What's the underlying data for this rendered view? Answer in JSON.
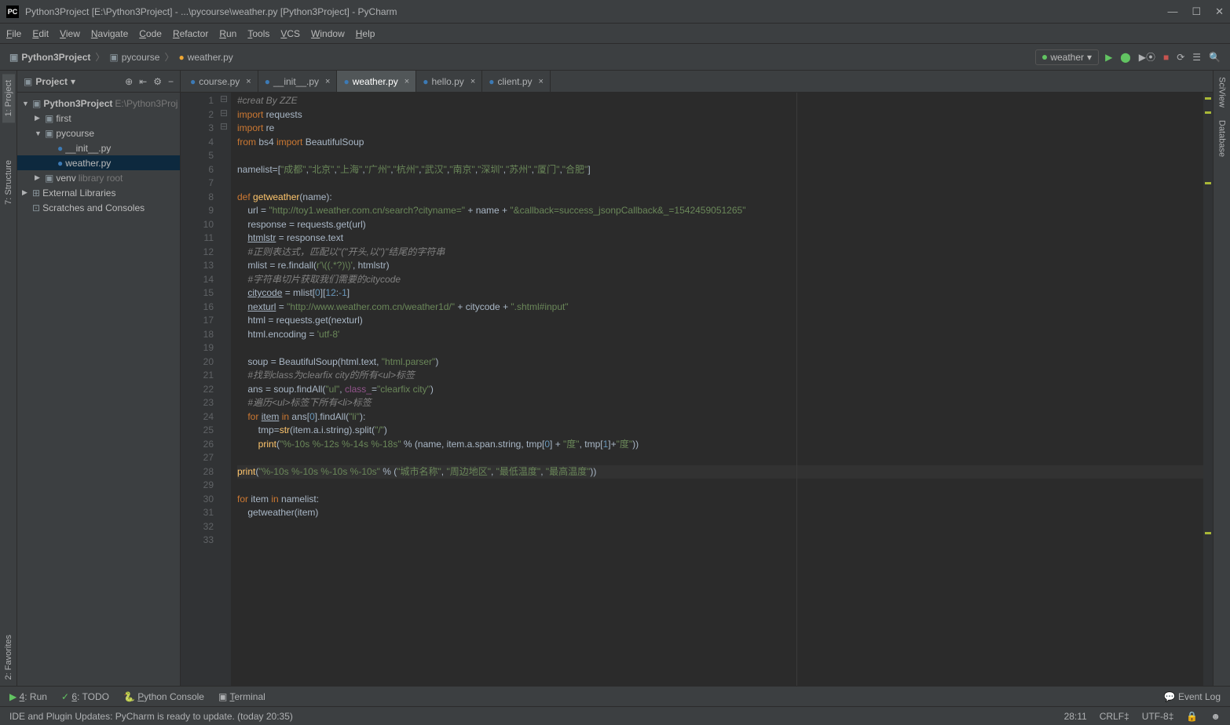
{
  "window": {
    "title": "Python3Project [E:\\Python3Project] - ...\\pycourse\\weather.py [Python3Project] - PyCharm"
  },
  "menus": [
    "File",
    "Edit",
    "View",
    "Navigate",
    "Code",
    "Refactor",
    "Run",
    "Tools",
    "VCS",
    "Window",
    "Help"
  ],
  "breadcrumb": [
    {
      "label": "Python3Project",
      "type": "folder"
    },
    {
      "label": "pycourse",
      "type": "folder"
    },
    {
      "label": "weather.py",
      "type": "py"
    }
  ],
  "runConfig": "weather",
  "project": {
    "title": "Project",
    "root": {
      "label": "Python3Project",
      "path": "E:\\Python3Proj"
    },
    "nodes": [
      {
        "depth": 0,
        "arrow": "▼",
        "icon": "folder",
        "label": "Python3Project",
        "suffix": "E:\\Python3Proj",
        "bold": true
      },
      {
        "depth": 1,
        "arrow": "▶",
        "icon": "folder",
        "label": "first"
      },
      {
        "depth": 1,
        "arrow": "▼",
        "icon": "folder",
        "label": "pycourse"
      },
      {
        "depth": 2,
        "arrow": "",
        "icon": "py",
        "label": "__init__.py"
      },
      {
        "depth": 2,
        "arrow": "",
        "icon": "py",
        "label": "weather.py",
        "selected": true
      },
      {
        "depth": 1,
        "arrow": "▶",
        "icon": "folder",
        "label": "venv",
        "suffix": "library root"
      },
      {
        "depth": 0,
        "arrow": "▶",
        "icon": "lib",
        "label": "External Libraries"
      },
      {
        "depth": 0,
        "arrow": "",
        "icon": "scratch",
        "label": "Scratches and Consoles"
      }
    ]
  },
  "tabs": [
    {
      "label": "course.py",
      "active": false
    },
    {
      "label": "__init__.py",
      "active": false
    },
    {
      "label": "weather.py",
      "active": true
    },
    {
      "label": "hello.py",
      "active": false
    },
    {
      "label": "client.py",
      "active": false
    }
  ],
  "leftTabs": [
    "1: Project",
    "7: Structure",
    "2: Favorites"
  ],
  "rightTabs": [
    "SciView",
    "Database"
  ],
  "code": {
    "lines": [
      {
        "n": 1,
        "t": "cmt",
        "v": "#creat By ZZE"
      },
      {
        "n": 2,
        "html": "<span class='kw'>import</span> requests"
      },
      {
        "n": 3,
        "html": "<span class='kw'>import</span> re"
      },
      {
        "n": 4,
        "html": "<span class='kw'>from</span> bs4 <span class='kw'>import</span> BeautifulSoup"
      },
      {
        "n": 5,
        "html": ""
      },
      {
        "n": 6,
        "html": "namelist=[<span class='str'>\"成都\"</span>,<span class='str'>\"北京\"</span>,<span class='str'>\"上海\"</span>,<span class='str'>\"广州\"</span>,<span class='str'>\"杭州\"</span>,<span class='str'>\"武汉\"</span>,<span class='str'>\"南京\"</span>,<span class='str'>\"深圳\"</span>,<span class='str'>\"苏州\"</span>,<span class='str'>\"厦门\"</span>,<span class='str'>\"合肥\"</span>]"
      },
      {
        "n": 7,
        "html": ""
      },
      {
        "n": 8,
        "html": "<span class='kw'>def</span> <span class='fn'>getweather</span>(name):"
      },
      {
        "n": 9,
        "html": "    url = <span class='str'>\"http://toy1.weather.com.cn/search?cityname=\"</span> + name + <span class='str'>\"&callback=success_jsonpCallback&_=1542459051265\"</span>"
      },
      {
        "n": 10,
        "html": "    response = requests.get(url)"
      },
      {
        "n": 11,
        "html": "    <span class='ul'>htmlstr</span> = response.text"
      },
      {
        "n": 12,
        "html": "    <span class='cmt'>#正则表达式，匹配以\"(\"开头,以\")\"结尾的字符串</span>"
      },
      {
        "n": 13,
        "html": "    mlist = re.findall(<span class='str'>r'\\((.*?)\\)'</span>, htmlstr)"
      },
      {
        "n": 14,
        "html": "    <span class='cmt'>#字符串切片获取我们需要的citycode</span>"
      },
      {
        "n": 15,
        "html": "    <span class='ul'>citycode</span> = mlist[<span class='num'>0</span>][<span class='num'>12</span>:<span class='num'>-1</span>]"
      },
      {
        "n": 16,
        "html": "    <span class='ul'>nexturl</span> = <span class='str'>\"http://www.weather.com.cn/weather1d/\"</span> + citycode + <span class='str'>\".shtml#input\"</span>"
      },
      {
        "n": 17,
        "html": "    html = requests.get(nexturl)"
      },
      {
        "n": 18,
        "html": "    html.encoding = <span class='str'>'utf-8'</span>"
      },
      {
        "n": 19,
        "html": ""
      },
      {
        "n": 20,
        "html": "    soup = BeautifulSoup(html.text, <span class='str'>\"html.parser\"</span>)"
      },
      {
        "n": 21,
        "html": "    <span class='cmt'>#找到class为clearfix city的所有&lt;ul&gt;标签</span>"
      },
      {
        "n": 22,
        "html": "    ans = soup.findAll(<span class='str'>\"ul\"</span>, <span class='self'>class_</span>=<span class='str'>\"clearfix city\"</span>)"
      },
      {
        "n": 23,
        "html": "    <span class='cmt'>#遍历&lt;ul&gt;标签下所有&lt;li&gt;标签</span>"
      },
      {
        "n": 24,
        "html": "    <span class='kw'>for</span> <span class='ul'>item</span> <span class='kw'>in</span> ans[<span class='num'>0</span>].findAll(<span class='str'>\"li\"</span>):"
      },
      {
        "n": 25,
        "html": "        tmp=<span class='fn'>str</span>(item.a.i.string).split(<span class='str'>\"/\"</span>)"
      },
      {
        "n": 26,
        "html": "        <span class='fn'>print</span>(<span class='str'>\"%-10s %-12s %-14s %-18s\"</span> % (name, item.a.span.string, tmp[<span class='num'>0</span>] + <span class='str'>\"度\"</span>, tmp[<span class='num'>1</span>]+<span class='str'>\"度\"</span>))"
      },
      {
        "n": 27,
        "html": ""
      },
      {
        "n": 28,
        "hl": true,
        "html": "<span class='fn'>print</span>(<span class='str'>\"%-10s %-10s %-10s %-10s\"</span> % (<span class='str'>\"城市名称\"</span>, <span class='str'>\"周边地区\"</span>, <span class='str'>\"最低温度\"</span>, <span class='str'>\"最高温度\"</span>))"
      },
      {
        "n": 29,
        "html": ""
      },
      {
        "n": 30,
        "html": "<span class='kw'>for</span> item <span class='kw'>in</span> namelist:"
      },
      {
        "n": 31,
        "html": "    getweather(item)"
      },
      {
        "n": 32,
        "html": ""
      },
      {
        "n": 33,
        "html": ""
      }
    ]
  },
  "bottomTools": [
    "4: Run",
    "6: TODO",
    "Python Console",
    "Terminal"
  ],
  "eventLog": "Event Log",
  "status": {
    "msg": "IDE and Plugin Updates: PyCharm is ready to update. (today 20:35)",
    "cursor": "28:11",
    "lineend": "CRLF‡",
    "encoding": "UTF-8‡"
  }
}
